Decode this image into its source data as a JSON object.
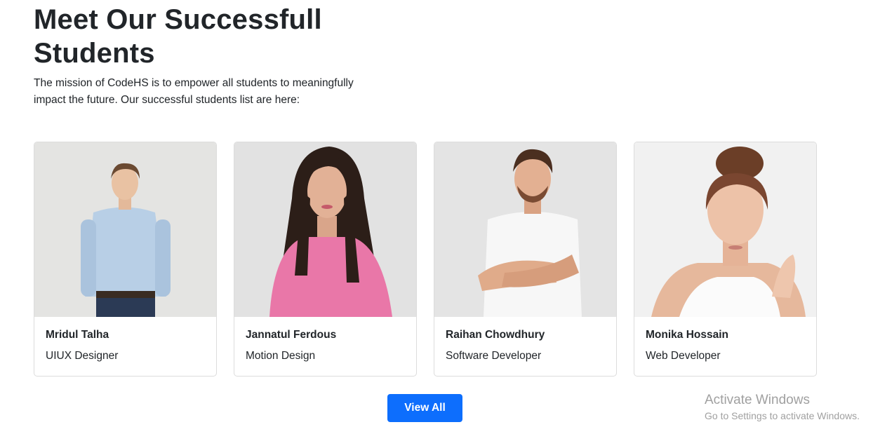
{
  "section": {
    "title": "Meet Our Successfull Students",
    "subtitle": "The mission of CodeHS is to empower all students to meaningfully impact the future. Our successful students list are here:"
  },
  "students": [
    {
      "name": "Mridul Talha",
      "role": "UIUX Designer"
    },
    {
      "name": "Jannatul Ferdous",
      "role": "Motion Design"
    },
    {
      "name": "Raihan Chowdhury",
      "role": "Software Developer"
    },
    {
      "name": "Monika Hossain",
      "role": "Web Developer"
    }
  ],
  "view_all_label": "View All",
  "watermark": {
    "title": "Activate Windows",
    "subtitle": "Go to Settings to activate Windows."
  },
  "colors": {
    "primary_button": "#0d6efd",
    "text": "#212529",
    "card_border": "#dcdcdc"
  }
}
